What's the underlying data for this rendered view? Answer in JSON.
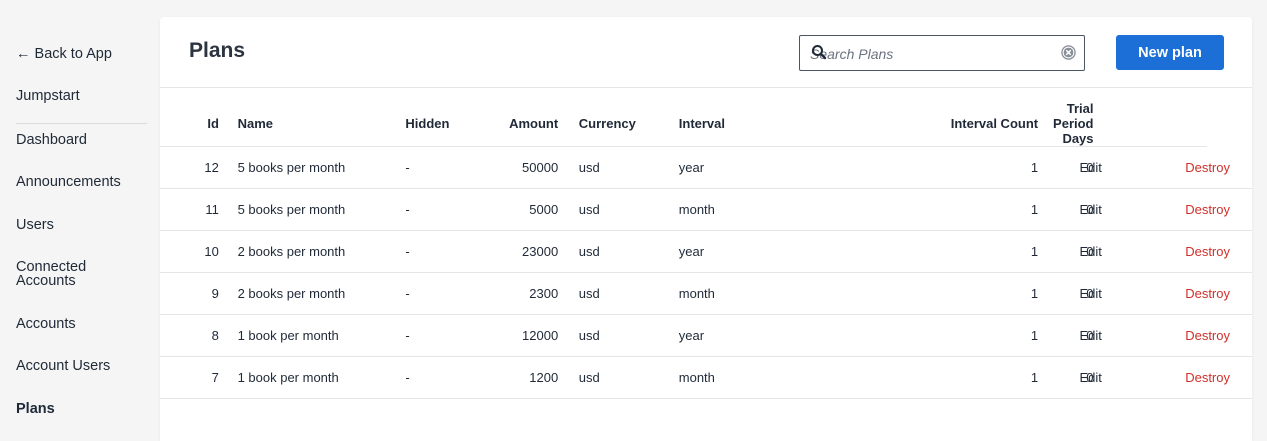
{
  "sidebar": {
    "back_label": "← Back to App",
    "brand": "Jumpstart",
    "items": [
      {
        "label": "Dashboard"
      },
      {
        "label": "Announcements"
      },
      {
        "label": "Users"
      },
      {
        "label": "Connected Accounts"
      },
      {
        "label": "Accounts"
      },
      {
        "label": "Account Users"
      },
      {
        "label": "Plans"
      }
    ],
    "active_item": "Plans"
  },
  "header": {
    "title": "Plans",
    "search_placeholder": "Search Plans",
    "new_button_label": "New plan"
  },
  "table": {
    "columns": [
      "Id",
      "Name",
      "Hidden",
      "Amount",
      "Currency",
      "Interval",
      "Interval Count",
      "Trial Period Days"
    ],
    "rows": [
      {
        "id": "12",
        "name": "5 books per month",
        "hidden": "-",
        "amount": "50000",
        "currency": "usd",
        "interval": "year",
        "interval_count": "1",
        "trial_days": "0",
        "edit": "Edit",
        "destroy": "Destroy"
      },
      {
        "id": "11",
        "name": "5 books per month",
        "hidden": "-",
        "amount": "5000",
        "currency": "usd",
        "interval": "month",
        "interval_count": "1",
        "trial_days": "0",
        "edit": "Edit",
        "destroy": "Destroy"
      },
      {
        "id": "10",
        "name": "2 books per month",
        "hidden": "-",
        "amount": "23000",
        "currency": "usd",
        "interval": "year",
        "interval_count": "1",
        "trial_days": "0",
        "edit": "Edit",
        "destroy": "Destroy"
      },
      {
        "id": "9",
        "name": "2 books per month",
        "hidden": "-",
        "amount": "2300",
        "currency": "usd",
        "interval": "month",
        "interval_count": "1",
        "trial_days": "0",
        "edit": "Edit",
        "destroy": "Destroy"
      },
      {
        "id": "8",
        "name": "1 book per month",
        "hidden": "-",
        "amount": "12000",
        "currency": "usd",
        "interval": "year",
        "interval_count": "1",
        "trial_days": "0",
        "edit": "Edit",
        "destroy": "Destroy"
      },
      {
        "id": "7",
        "name": "1 book per month",
        "hidden": "-",
        "amount": "1200",
        "currency": "usd",
        "interval": "month",
        "interval_count": "1",
        "trial_days": "0",
        "edit": "Edit",
        "destroy": "Destroy"
      }
    ]
  },
  "colors": {
    "accent": "#1b6fd6",
    "danger": "#d0302a",
    "background": "#f4f5f4",
    "panel": "#ffffff"
  },
  "icons": {
    "search": "search-icon",
    "clear": "clear-icon"
  }
}
